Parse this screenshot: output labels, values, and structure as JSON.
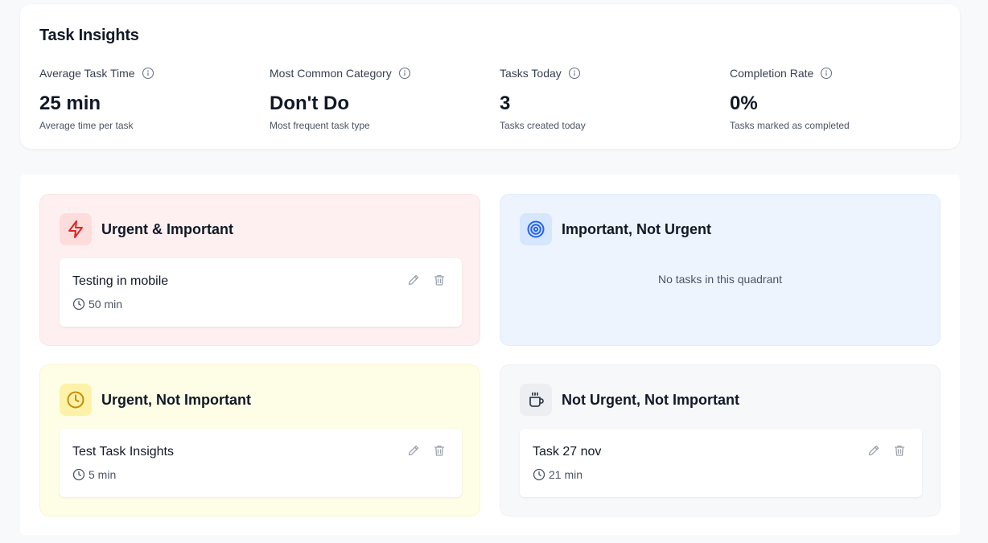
{
  "insights": {
    "title": "Task Insights",
    "stats": [
      {
        "label": "Average Task Time",
        "value": "25 min",
        "desc": "Average time per task"
      },
      {
        "label": "Most Common Category",
        "value": "Don't Do",
        "desc": "Most frequent task type"
      },
      {
        "label": "Tasks Today",
        "value": "3",
        "desc": "Tasks created today"
      },
      {
        "label": "Completion Rate",
        "value": "0%",
        "desc": "Tasks marked as completed"
      }
    ]
  },
  "quadrants": {
    "urgent_important": {
      "title": "Urgent & Important",
      "icon": "lightning-icon",
      "color": "#dc2626",
      "tasks": [
        {
          "name": "Testing in mobile",
          "time": "50 min"
        }
      ]
    },
    "important_not_urgent": {
      "title": "Important, Not Urgent",
      "icon": "target-icon",
      "color": "#2563eb",
      "empty_text": "No tasks in this quadrant"
    },
    "urgent_not_important": {
      "title": "Urgent, Not Important",
      "icon": "clock-icon",
      "color": "#ca8a04",
      "tasks": [
        {
          "name": "Test Task Insights",
          "time": "5 min"
        }
      ]
    },
    "not_urgent_not_important": {
      "title": "Not Urgent, Not Important",
      "icon": "coffee-cup-icon",
      "color": "#374151",
      "tasks": [
        {
          "name": "Task 27 nov",
          "time": "21 min"
        }
      ]
    }
  }
}
